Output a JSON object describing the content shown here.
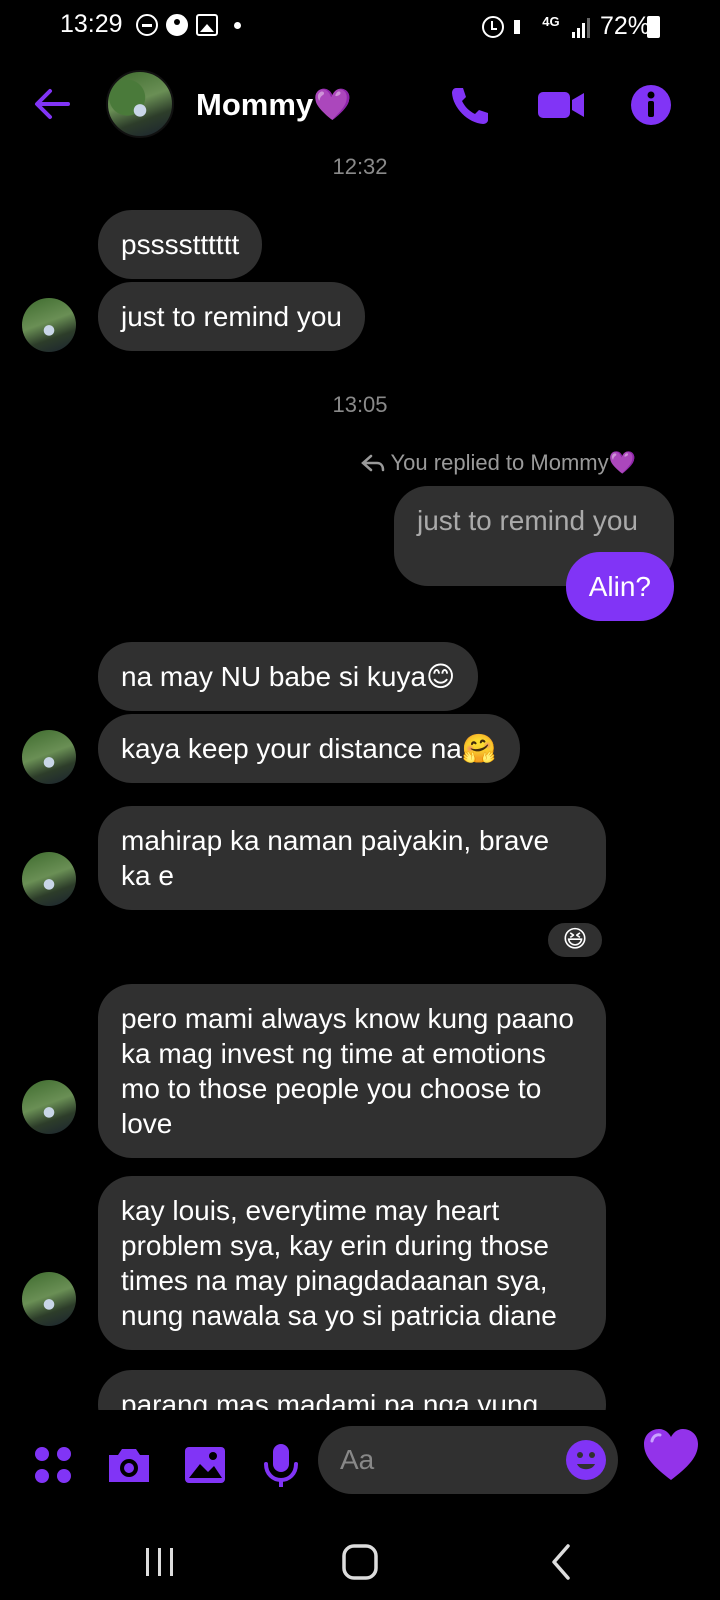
{
  "status_bar": {
    "time": "13:29",
    "network": "4G",
    "battery": "72%"
  },
  "header": {
    "contact_name": "Mommy💜",
    "accent_color": "#8134f6"
  },
  "chat": {
    "timestamp_1": "12:32",
    "msg_1": "psssstttttt",
    "msg_2": "just to remind you",
    "timestamp_2": "13:05",
    "reply_label": "You replied to Mommy💜",
    "quoted_text": "just to remind you",
    "out_msg": "Alin?",
    "msg_3": "na may NU babe si kuya😊",
    "msg_4": "kaya keep your distance na🤗",
    "msg_5": "mahirap ka naman paiyakin, brave ka e",
    "reaction_5": "😆",
    "msg_6": "pero mami always know kung paano ka mag invest ng time at emotions mo to those people you choose to love",
    "msg_7": "kay louis, everytime may heart problem sya, kay erin during those times na may pinagdadaanan sya, nung nawala sa yo si patricia diane",
    "msg_8": "parang mas madami pa nga yung"
  },
  "composer": {
    "placeholder": "Aa",
    "like_emoji": "💜"
  }
}
